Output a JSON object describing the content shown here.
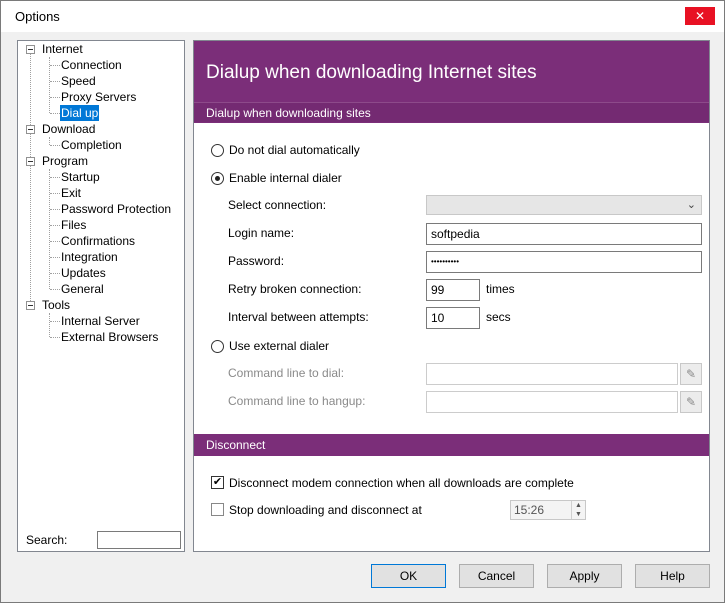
{
  "window": {
    "title": "Options",
    "close_glyph": "✕"
  },
  "tree": {
    "nodes": [
      {
        "label": "Internet"
      },
      {
        "label": "Connection"
      },
      {
        "label": "Speed"
      },
      {
        "label": "Proxy Servers"
      },
      {
        "label": "Dial up"
      },
      {
        "label": "Download"
      },
      {
        "label": "Completion"
      },
      {
        "label": "Program"
      },
      {
        "label": "Startup"
      },
      {
        "label": "Exit"
      },
      {
        "label": "Password Protection"
      },
      {
        "label": "Files"
      },
      {
        "label": "Confirmations"
      },
      {
        "label": "Integration"
      },
      {
        "label": "Updates"
      },
      {
        "label": "General"
      },
      {
        "label": "Tools"
      },
      {
        "label": "Internal Server"
      },
      {
        "label": "External Browsers"
      }
    ],
    "search_label": "Search:",
    "search_value": ""
  },
  "panel": {
    "title": "Dialup when downloading Internet sites",
    "section1": "Dialup when downloading sites",
    "radio_no_dial": "Do not dial automatically",
    "radio_internal": "Enable internal dialer",
    "select_connection_label": "Select connection:",
    "select_connection_value": "",
    "login_label": "Login name:",
    "login_value": "softpedia",
    "password_label": "Password:",
    "password_value": "••••••••••",
    "retry_label": "Retry broken connection:",
    "retry_value": "99",
    "retry_unit": "times",
    "interval_label": "Interval between attempts:",
    "interval_value": "10",
    "interval_unit": "secs",
    "radio_external": "Use external dialer",
    "cmd_dial_label": "Command line to dial:",
    "cmd_dial_value": "",
    "cmd_hangup_label": "Command line to hangup:",
    "cmd_hangup_value": "",
    "section2": "Disconnect",
    "chk_disconnect": "Disconnect modem connection when all downloads are complete",
    "chk_stop": "Stop downloading and disconnect at",
    "time_value": "15:26"
  },
  "buttons": {
    "ok": "OK",
    "cancel": "Cancel",
    "apply": "Apply",
    "help": "Help"
  },
  "colors": {
    "accent": "#7b2e79",
    "selection": "#0078d7"
  }
}
